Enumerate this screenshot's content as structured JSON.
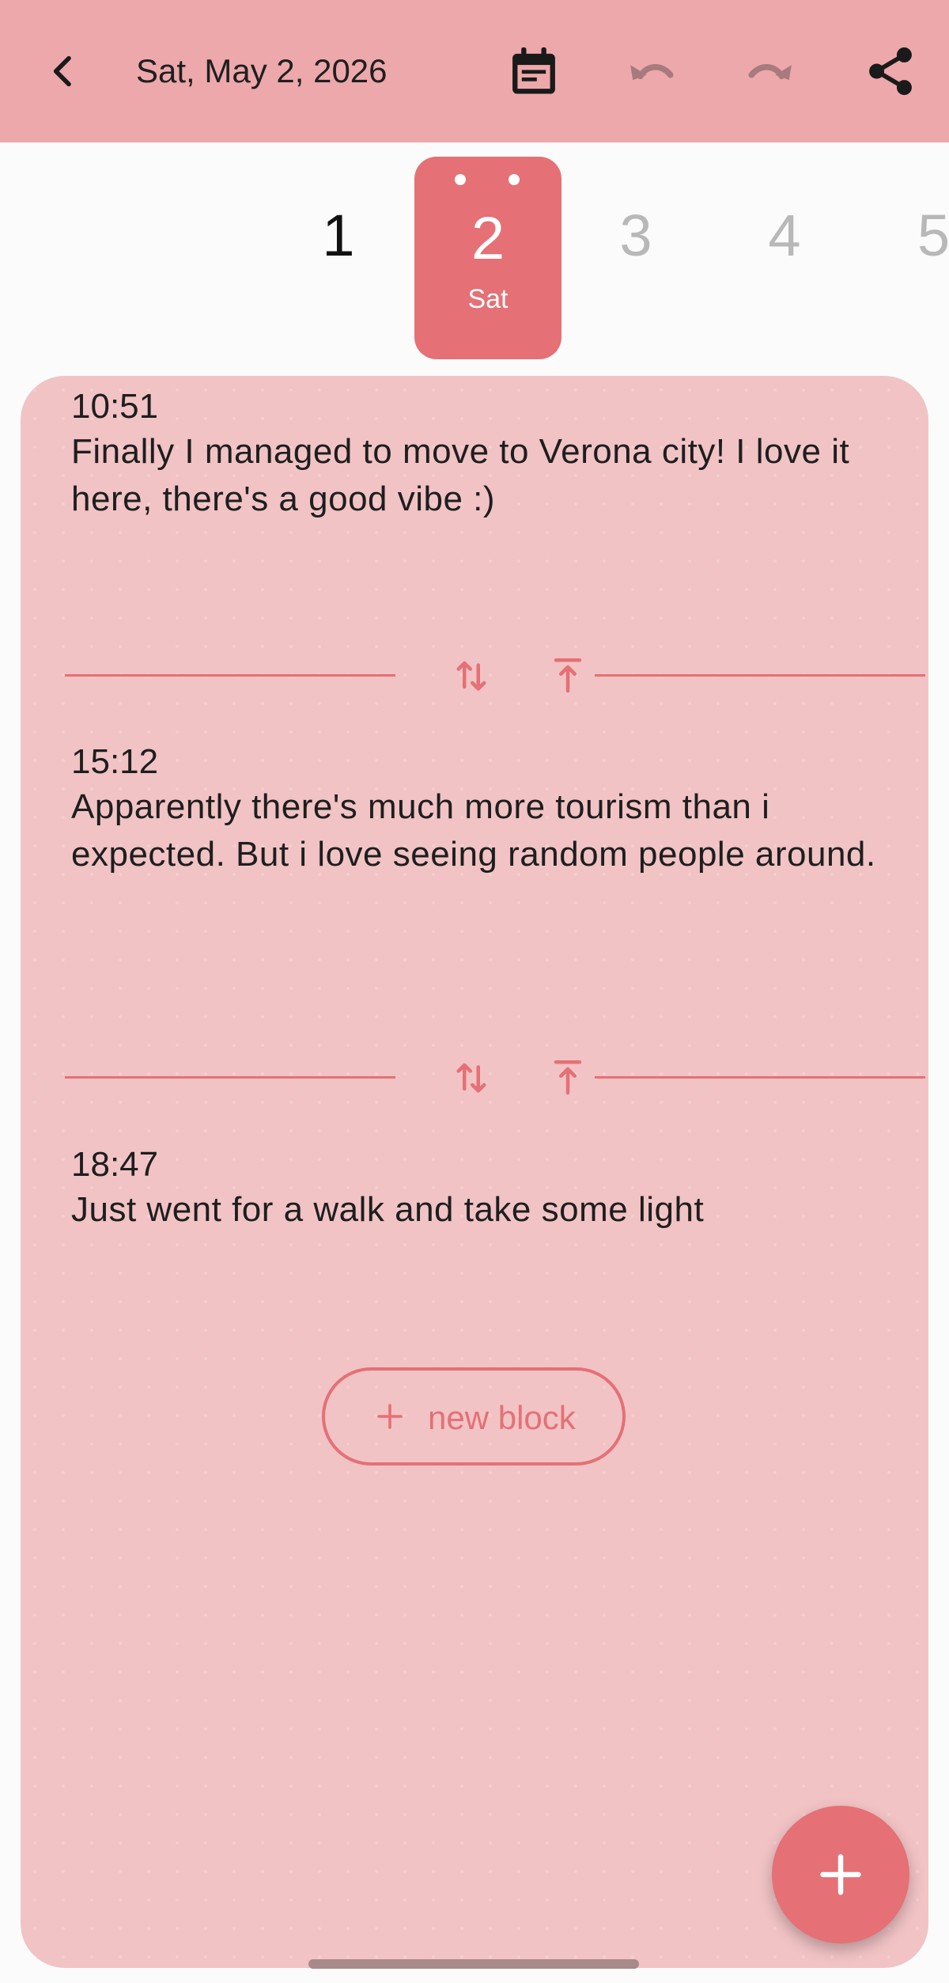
{
  "appbar": {
    "date": "Sat, May 2, 2026",
    "icons": [
      "back-arrow-icon",
      "calendar-icon",
      "undo-icon",
      "redo-icon",
      "share-icon"
    ],
    "color": "#eda8ab"
  },
  "day_picker": {
    "days": [
      "1",
      "3",
      "4",
      "5"
    ],
    "selected": {
      "day": "2",
      "weekday": "Sat"
    },
    "accent": "#e57075"
  },
  "entries": [
    {
      "time": "10:51",
      "text": "Finally I managed to move to Verona city! I love it here, there's a good vibe :)"
    },
    {
      "time": "15:12",
      "text": "Apparently there's much more tourism than i expected. But i love seeing random people around."
    },
    {
      "time": "18:47",
      "text": "Just went for a walk and take some light"
    }
  ],
  "new_block": {
    "label": "new block"
  },
  "fab": {
    "icon": "plus-icon"
  }
}
